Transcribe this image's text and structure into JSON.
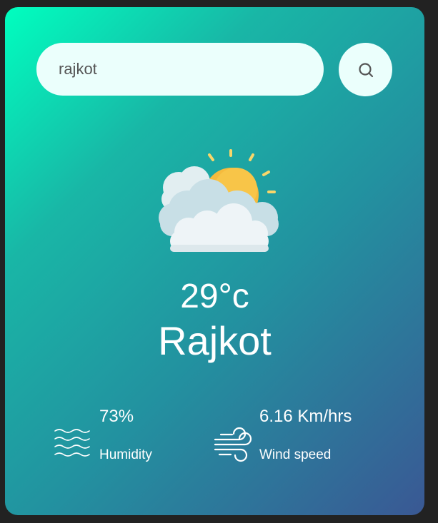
{
  "search": {
    "value": "rajkot",
    "placeholder": "",
    "button_icon": "search-icon"
  },
  "weather": {
    "condition_icon": "partly-cloudy-icon",
    "temperature": "29°c",
    "city": "Rajkot"
  },
  "details": {
    "humidity": {
      "icon": "humidity-waves-icon",
      "value": "73%",
      "label": "Humidity"
    },
    "wind": {
      "icon": "wind-icon",
      "value": "6.16 Km/hrs",
      "label": "Wind speed"
    }
  },
  "colors": {
    "gradient_start": "#00ffbf",
    "gradient_end": "#3a5894",
    "search_bg": "#ebfffc",
    "text": "#ffffff"
  }
}
